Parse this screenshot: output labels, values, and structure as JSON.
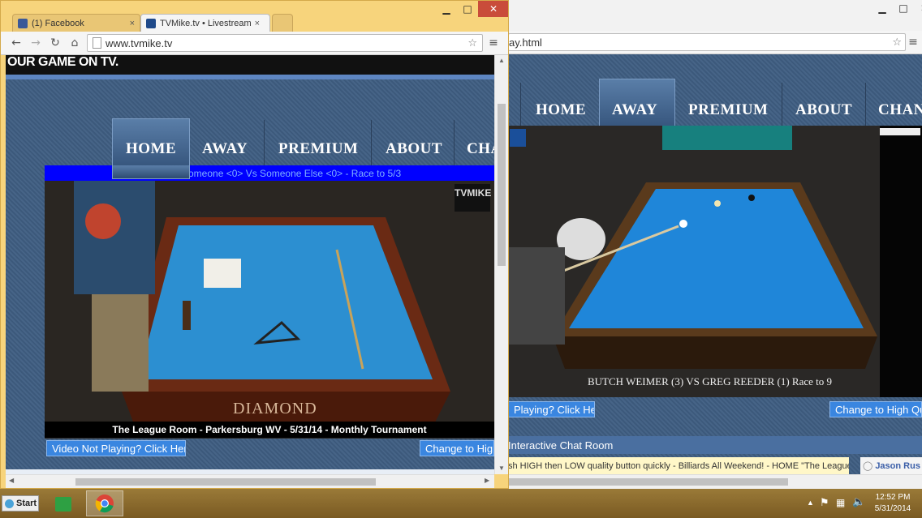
{
  "left_window": {
    "tabs": [
      {
        "label": "(1) Facebook",
        "active": false,
        "icon": "facebook-icon"
      },
      {
        "label": "TVMike.tv • Livestream",
        "active": true,
        "icon": "tvmike-icon"
      }
    ],
    "url": "www.tvmike.tv",
    "banner_text": "OUR GAME ON TV.",
    "nav": [
      "HOME",
      "AWAY",
      "PREMIUM",
      "ABOUT",
      "CHA"
    ],
    "ticker": "omeone <0> Vs Someone Else <0> - Race to 5/3",
    "video_brand": "TVMIKE",
    "table_brand": "DIAMOND",
    "caption": "The League Room - Parkersburg WV - 5/31/14 - Monthly Tournament",
    "btn_not_playing": "Video Not Playing? Click Here",
    "btn_high_quality": "Change to High"
  },
  "right_window": {
    "url": "ay.html",
    "nav": [
      "HOME",
      "AWAY",
      "PREMIUM",
      "ABOUT",
      "CHAN"
    ],
    "scoreboard": "BUTCH WEIMER (3) VS  GREG REEDER (1)  Race to 9",
    "btn_not_playing": "Playing? Click Here",
    "btn_high_quality": "Change to High Qua",
    "chat_title": "Interactive Chat Room",
    "chat_message": "sh HIGH then LOW quality button quickly - Billiards All Weekend! - HOME \"The League",
    "chat_user": "Jason Rus"
  },
  "taskbar": {
    "start_label": "Start",
    "time": "12:52 PM",
    "date": "5/31/2014"
  },
  "colors": {
    "page_blue": "#3f5e82",
    "ticker_blue": "#0000ff",
    "felt_blue": "#2c8fd1",
    "button_blue": "#3a86e0"
  }
}
